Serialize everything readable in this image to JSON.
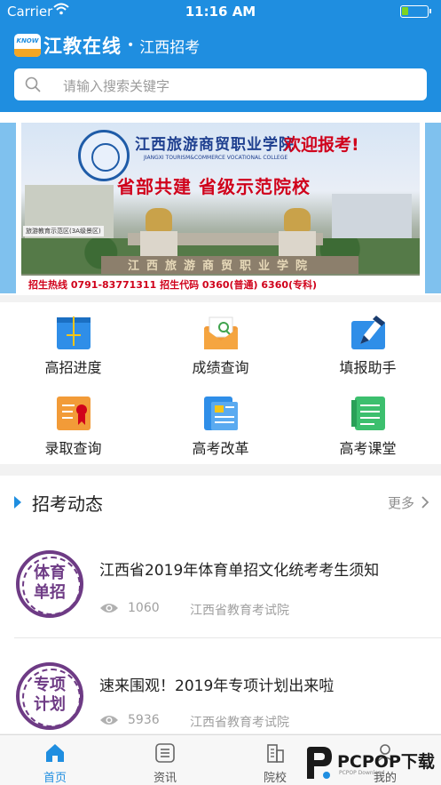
{
  "status_bar": {
    "carrier": "Carrier",
    "time": "11:16 AM",
    "battery_level": 0.25
  },
  "header": {
    "logo_text": "KNOW",
    "brand": "江教在线",
    "separator": "•",
    "region": "江西招考",
    "search_placeholder": "请输入搜索关键字",
    "accent_color": "#1f8ee0"
  },
  "banner": {
    "school_name_cn": "江西旅游商贸职业学院",
    "school_name_en": "JIANGXI TOURISM&COMMERCE VOCATIONAL COLLEGE",
    "welcome": "欢迎报考!",
    "slogan": "省部共建  省级示范院校",
    "sign": "旅游教育示范区(3A级景区)",
    "wall_text": "江西旅游商贸职业学院",
    "footer_text": "招生热线  0791-83771311  招生代码  0360(普通)  6360(专科)"
  },
  "grid": [
    {
      "label": "高招进度",
      "icon": "progress-icon"
    },
    {
      "label": "成绩查询",
      "icon": "score-envelope-icon"
    },
    {
      "label": "填报助手",
      "icon": "pen-assistant-icon"
    },
    {
      "label": "录取查询",
      "icon": "admission-certificate-icon"
    },
    {
      "label": "高考改革",
      "icon": "reform-document-icon"
    },
    {
      "label": "高考课堂",
      "icon": "classroom-notebook-icon"
    }
  ],
  "news_section": {
    "title": "招考动态",
    "more": "更多",
    "items": [
      {
        "stamp_line1": "体育",
        "stamp_line2": "单招",
        "title": "江西省2019年体育单招文化统考考生须知",
        "views": "1060",
        "source": "江西省教育考试院"
      },
      {
        "stamp_line1": "专项",
        "stamp_line2": "计划",
        "title": "速来围观！2019年专项计划出来啦",
        "views": "5936",
        "source": "江西省教育考试院"
      }
    ]
  },
  "tabbar": [
    {
      "label": "首页",
      "icon": "home-icon",
      "active": true
    },
    {
      "label": "资讯",
      "icon": "news-icon",
      "active": false
    },
    {
      "label": "院校",
      "icon": "school-icon",
      "active": false
    },
    {
      "label": "我的",
      "icon": "profile-icon",
      "active": false
    }
  ],
  "watermark": {
    "text": "PCPOP下载",
    "sub": "PCPOP Download"
  }
}
